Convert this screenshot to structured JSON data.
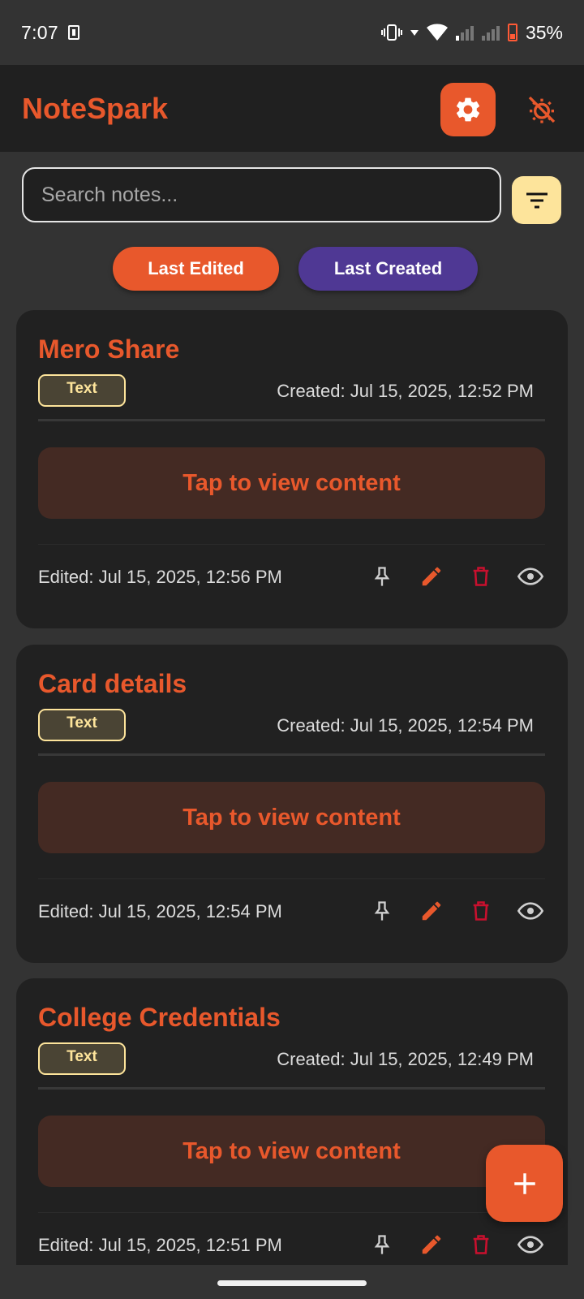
{
  "status_bar": {
    "time": "7:07",
    "battery": "35%"
  },
  "app": {
    "title": "NoteSpark",
    "accent": "#e8582c"
  },
  "search": {
    "placeholder": "Search notes..."
  },
  "sort": {
    "last_edited": "Last Edited",
    "last_created": "Last Created"
  },
  "notes": [
    {
      "title": "Mero Share",
      "tag": "Text",
      "created": "Created: Jul 15, 2025, 12:52 PM",
      "content_prompt": "Tap to view content",
      "edited": "Edited: Jul 15, 2025, 12:56 PM"
    },
    {
      "title": "Card details",
      "tag": "Text",
      "created": "Created: Jul 15, 2025, 12:54 PM",
      "content_prompt": "Tap to view content",
      "edited": "Edited: Jul 15, 2025, 12:54 PM"
    },
    {
      "title": "College Credentials",
      "tag": "Text",
      "created": "Created: Jul 15, 2025, 12:49 PM",
      "content_prompt": "Tap to view content",
      "edited": "Edited: Jul 15, 2025, 12:51 PM"
    }
  ],
  "icons": {
    "settings": "gear-icon",
    "theme": "theme-toggle-icon",
    "filter": "filter-icon",
    "pin": "pin-icon",
    "edit": "pencil-icon",
    "delete": "trash-icon",
    "view": "eye-icon",
    "add": "plus-icon"
  }
}
